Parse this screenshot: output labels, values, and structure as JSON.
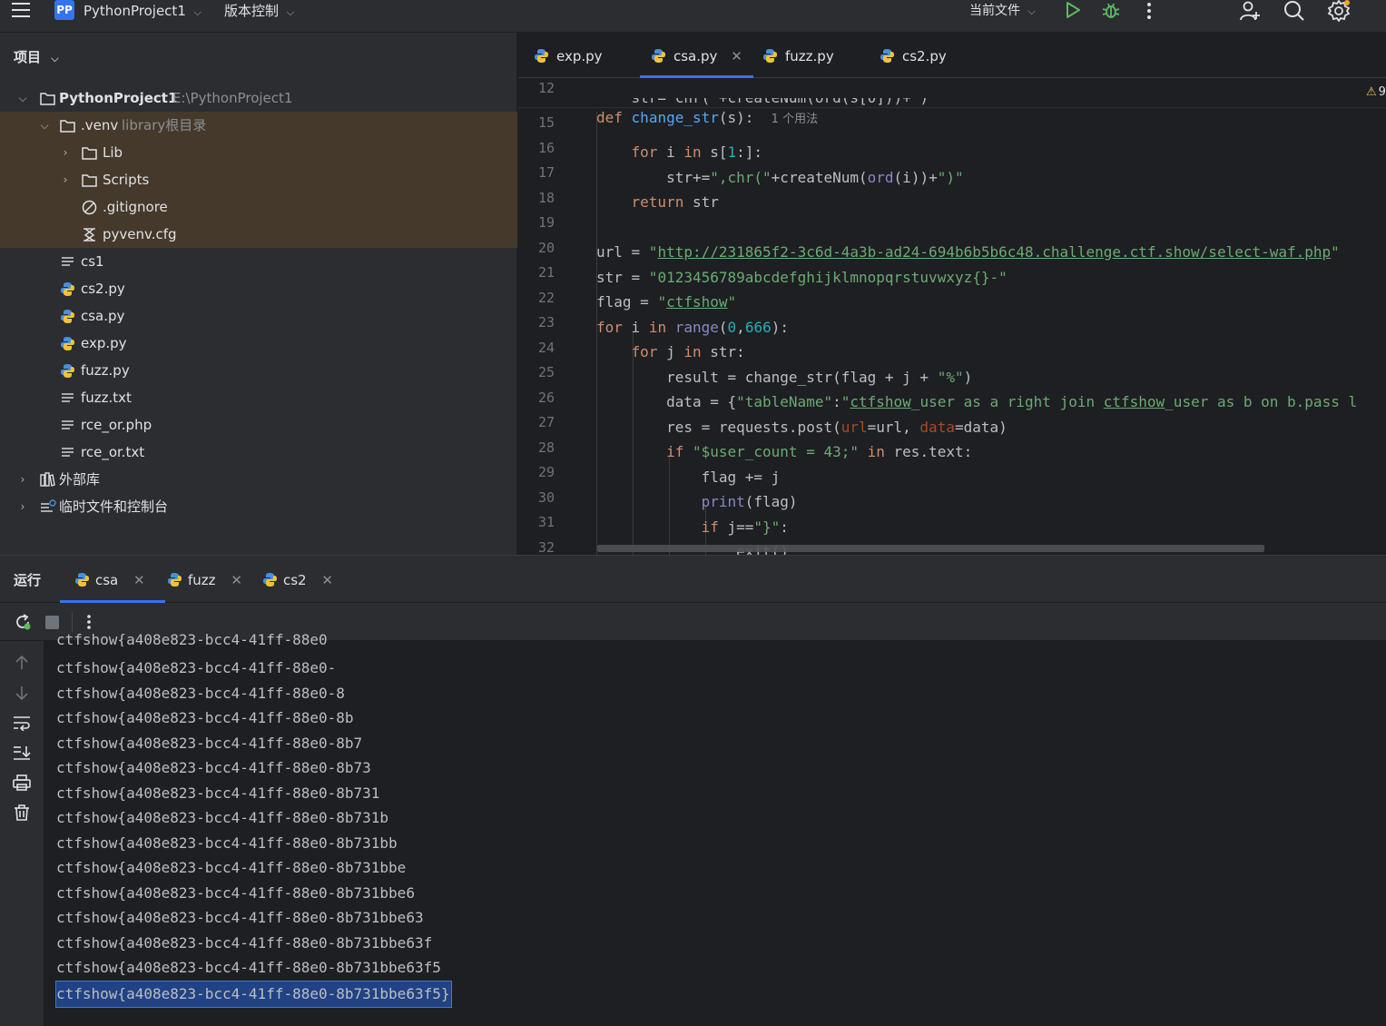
{
  "titlebar": {
    "badge": "PP",
    "project_name": "PythonProject1",
    "vcs_label": "版本控制",
    "run_config": "当前文件"
  },
  "project_panel": {
    "header": "项目",
    "tree": [
      {
        "label": "PythonProject1",
        "note": "E:\\PythonProject1",
        "icon": "folder-icon"
      },
      {
        "label": ".venv",
        "note": "library根目录",
        "icon": "folder-icon"
      },
      {
        "label": "Lib",
        "icon": "folder-icon"
      },
      {
        "label": "Scripts",
        "icon": "folder-icon"
      },
      {
        "label": ".gitignore",
        "icon": "ignore-file-icon"
      },
      {
        "label": "pyvenv.cfg",
        "icon": "config-file-icon"
      },
      {
        "label": "cs1",
        "icon": "text-file-icon"
      },
      {
        "label": "cs2.py",
        "icon": "python-file-icon"
      },
      {
        "label": "csa.py",
        "icon": "python-file-icon"
      },
      {
        "label": "exp.py",
        "icon": "python-file-icon"
      },
      {
        "label": "fuzz.py",
        "icon": "python-file-icon"
      },
      {
        "label": "fuzz.txt",
        "icon": "text-file-icon"
      },
      {
        "label": "rce_or.php",
        "icon": "text-file-icon"
      },
      {
        "label": "rce_or.txt",
        "icon": "text-file-icon"
      },
      {
        "label": "外部库",
        "icon": "library-icon"
      },
      {
        "label": "临时文件和控制台",
        "icon": "scratches-icon"
      }
    ]
  },
  "editor": {
    "tabs": [
      {
        "label": "exp.py"
      },
      {
        "label": "csa.py",
        "active": true
      },
      {
        "label": "fuzz.py"
      },
      {
        "label": "cs2.py"
      }
    ],
    "line_numbers": [
      "12",
      "15",
      "16",
      "17",
      "18",
      "19",
      "20",
      "21",
      "22",
      "23",
      "24",
      "25",
      "26",
      "27",
      "28",
      "29",
      "30",
      "31",
      "32"
    ],
    "usage_hint": "1 个用法",
    "warning_count": "9",
    "url": "http://231865f2-3c6d-4a3b-ad24-694b6b5b6c48.challenge.ctf.show/select-waf.php",
    "charset": "0123456789abcdefghijklmnopqrstuvwxyz{}-",
    "flag_init": "ctfshow"
  },
  "run_panel": {
    "label": "运行",
    "tabs": [
      {
        "label": "csa",
        "active": true
      },
      {
        "label": "fuzz"
      },
      {
        "label": "cs2"
      }
    ],
    "output": [
      "ctfshow{a408e823-bcc4-41ff-88e0",
      "ctfshow{a408e823-bcc4-41ff-88e0-",
      "ctfshow{a408e823-bcc4-41ff-88e0-8",
      "ctfshow{a408e823-bcc4-41ff-88e0-8b",
      "ctfshow{a408e823-bcc4-41ff-88e0-8b7",
      "ctfshow{a408e823-bcc4-41ff-88e0-8b73",
      "ctfshow{a408e823-bcc4-41ff-88e0-8b731",
      "ctfshow{a408e823-bcc4-41ff-88e0-8b731b",
      "ctfshow{a408e823-bcc4-41ff-88e0-8b731bb",
      "ctfshow{a408e823-bcc4-41ff-88e0-8b731bbe",
      "ctfshow{a408e823-bcc4-41ff-88e0-8b731bbe6",
      "ctfshow{a408e823-bcc4-41ff-88e0-8b731bbe63",
      "ctfshow{a408e823-bcc4-41ff-88e0-8b731bbe63f",
      "ctfshow{a408e823-bcc4-41ff-88e0-8b731bbe63f5",
      "ctfshow{a408e823-bcc4-41ff-88e0-8b731bbe63f5}"
    ]
  },
  "colors": {
    "accent": "#3574f0",
    "selection": "#214283",
    "venv_highlight": "#45392b",
    "keyword": "#cf8e6d",
    "string": "#6aab73",
    "function": "#56a8f5"
  }
}
